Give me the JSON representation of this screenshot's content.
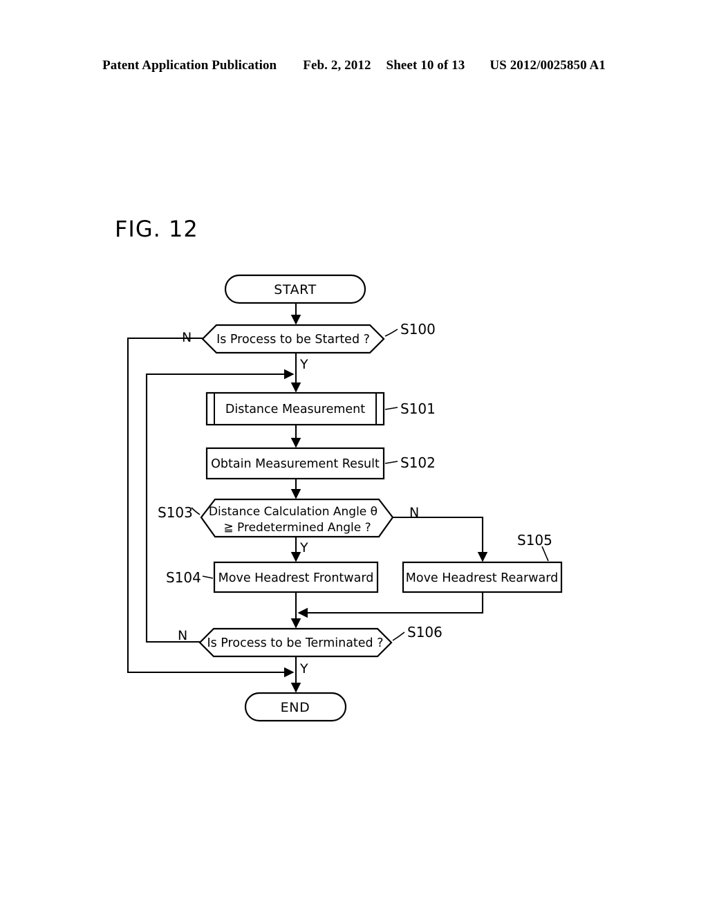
{
  "header": {
    "publication": "Patent Application Publication",
    "date": "Feb. 2, 2012",
    "sheet": "Sheet 10 of 13",
    "patent_number": "US 2012/0025850 A1"
  },
  "figure": {
    "label": "FIG. 12"
  },
  "flowchart": {
    "nodes": {
      "start": {
        "label": "START",
        "ref": ""
      },
      "s100": {
        "label": "Is Process to be Started ?",
        "ref": "S100",
        "shape": "decision"
      },
      "s101": {
        "label": "Distance Measurement",
        "ref": "S101",
        "shape": "predefined-process"
      },
      "s102": {
        "label": "Obtain Measurement Result",
        "ref": "S102",
        "shape": "process"
      },
      "s103": {
        "label_line1": "Distance Calculation Angle θ",
        "label_line2": "≧ Predetermined Angle ?",
        "ref": "S103",
        "shape": "decision"
      },
      "s104": {
        "label": "Move Headrest Frontward",
        "ref": "S104",
        "shape": "process"
      },
      "s105": {
        "label": "Move Headrest Rearward",
        "ref": "S105",
        "shape": "process"
      },
      "s106": {
        "label": "Is Process to be Terminated ?",
        "ref": "S106",
        "shape": "decision"
      },
      "end": {
        "label": "END",
        "ref": ""
      }
    },
    "branch_labels": {
      "s100_no": "N",
      "s100_yes": "Y",
      "s103_no": "N",
      "s103_yes": "Y",
      "s106_no": "N",
      "s106_yes": "Y"
    },
    "colors": {
      "ink": "#000000",
      "paper": "#ffffff"
    }
  }
}
